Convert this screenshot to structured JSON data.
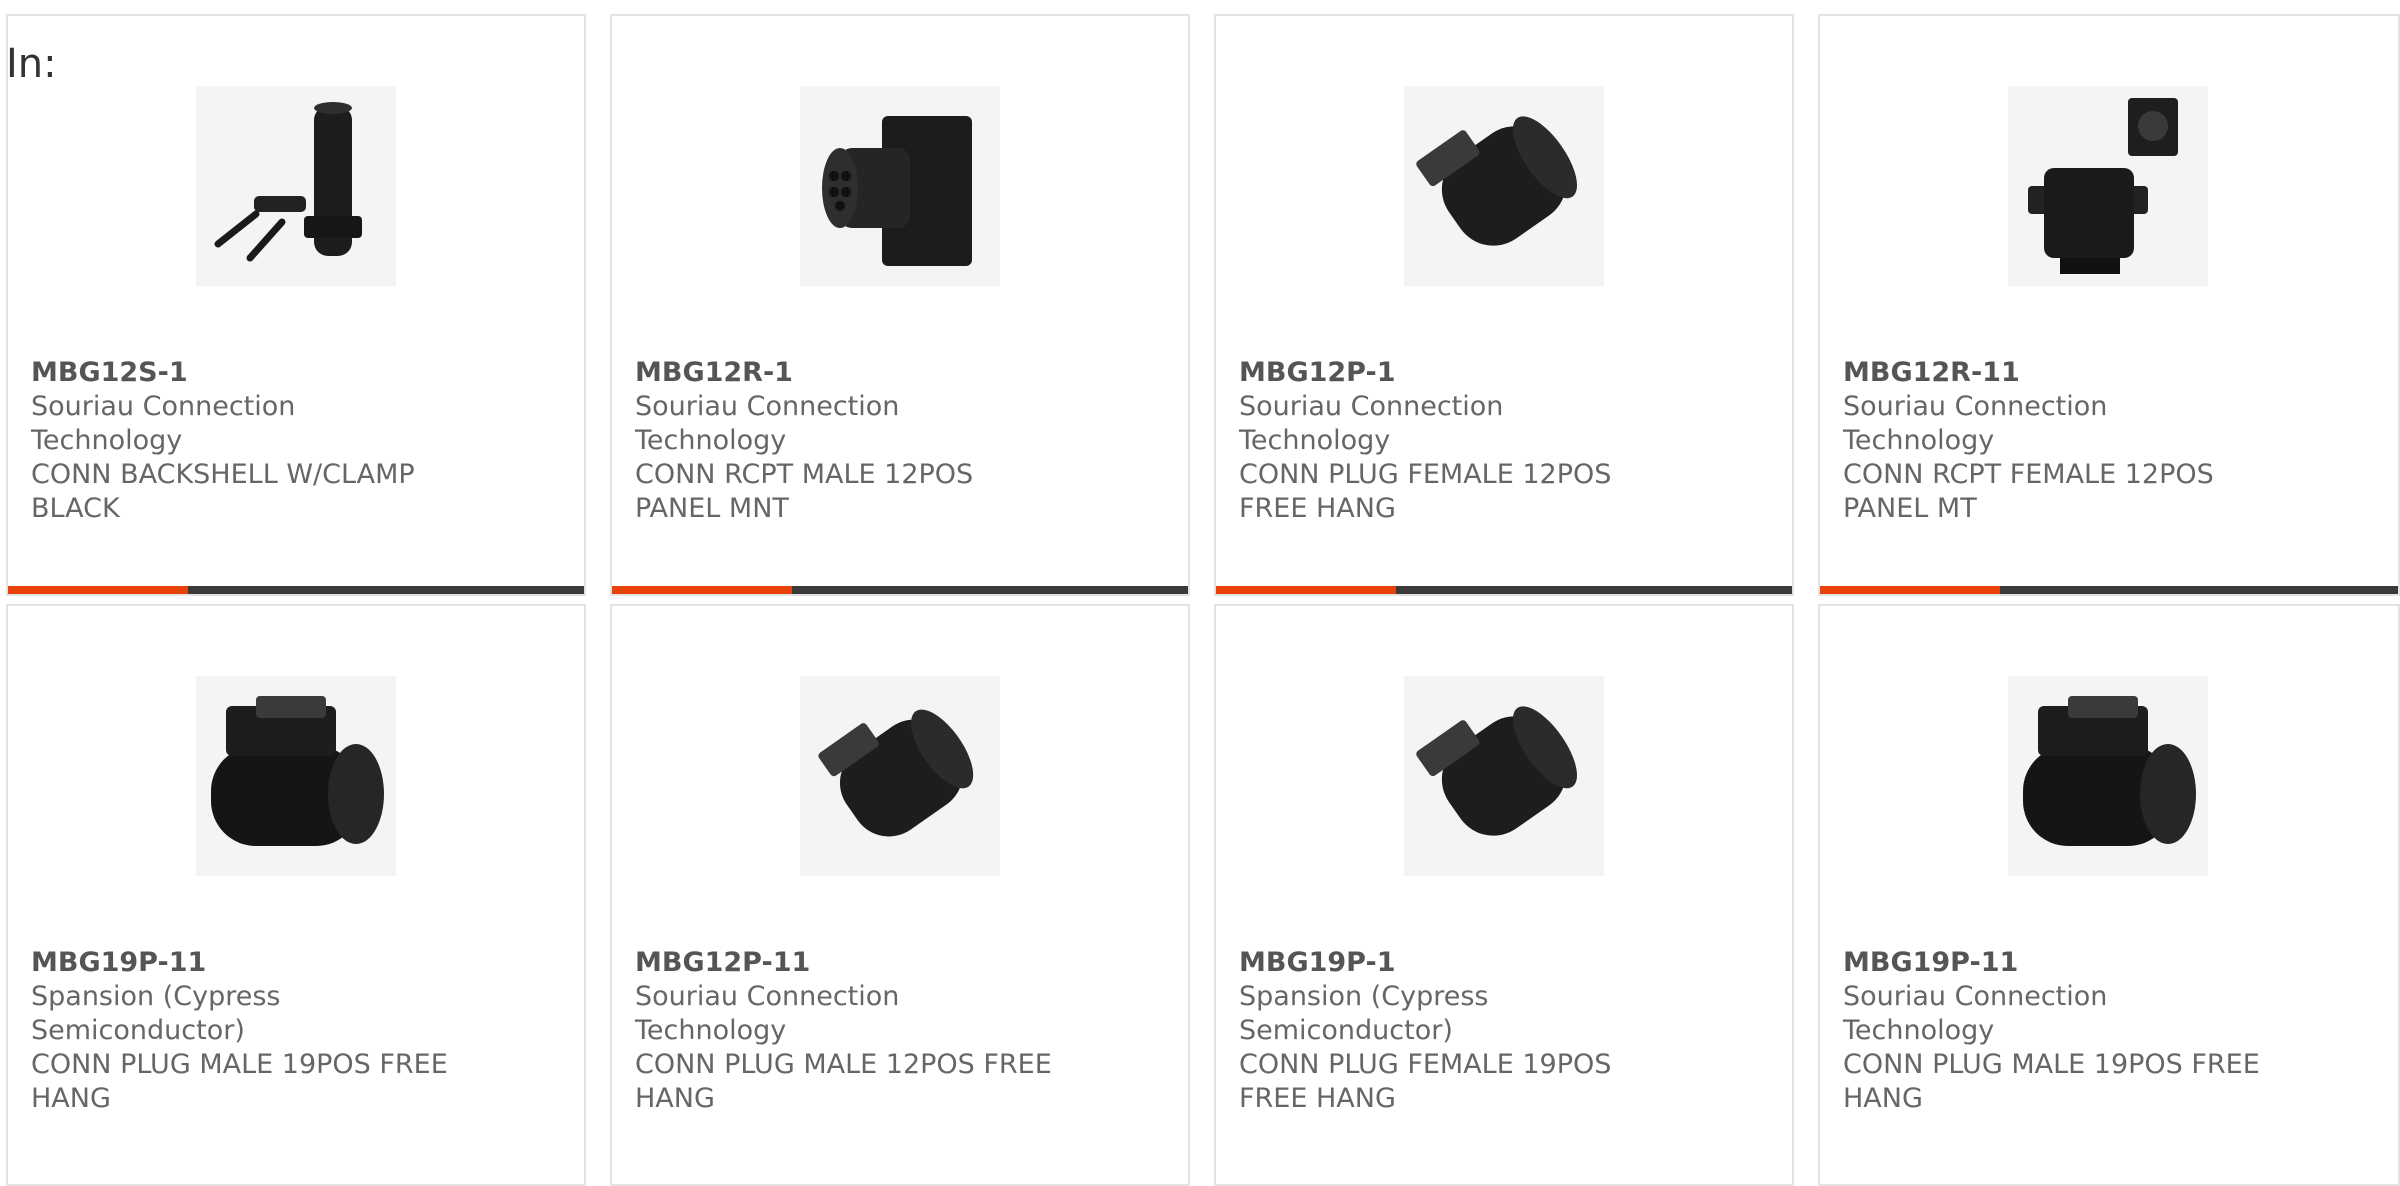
{
  "header": {
    "label": "In:"
  },
  "accent_color": "#e8410a",
  "bar_color": "#3a3a3a",
  "products": [
    {
      "part": "MBG12S-1",
      "manufacturer": "Souriau Connection Technology",
      "description": "CONN BACKSHELL W/CLAMP BLACK",
      "image": "backshell-clamp-image"
    },
    {
      "part": "MBG12R-1",
      "manufacturer": "Souriau Connection Technology",
      "description": "CONN RCPT MALE 12POS PANEL MNT",
      "image": "receptacle-panel-image"
    },
    {
      "part": "MBG12P-1",
      "manufacturer": "Souriau Connection Technology",
      "description": "CONN PLUG FEMALE 12POS FREE HANG",
      "image": "plug-angled-image"
    },
    {
      "part": "MBG12R-11",
      "manufacturer": "Souriau Connection Technology",
      "description": "CONN RCPT FEMALE 12POS PANEL MT",
      "image": "receptacle-pair-image"
    },
    {
      "part": "MBG19P-11",
      "manufacturer": "Spansion (Cypress Semiconductor)",
      "description": "CONN PLUG MALE 19POS FREE HANG",
      "image": "plug-side-image"
    },
    {
      "part": "MBG12P-11",
      "manufacturer": "Souriau Connection Technology",
      "description": "CONN PLUG MALE 12POS FREE HANG",
      "image": "plug-angled-image"
    },
    {
      "part": "MBG19P-1",
      "manufacturer": "Spansion (Cypress Semiconductor)",
      "description": "CONN PLUG FEMALE 19POS FREE HANG",
      "image": "plug-angled-image"
    },
    {
      "part": "MBG19P-11",
      "manufacturer": "Souriau Connection Technology",
      "description": "CONN PLUG MALE 19POS FREE HANG",
      "image": "plug-side-image"
    }
  ]
}
